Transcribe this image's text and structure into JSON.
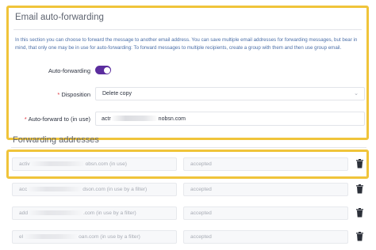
{
  "email_forwarding": {
    "title": "Email auto-forwarding",
    "description": "In this section you can choose to forward the message to another email address. You can save multiple email addresses for forwarding messages, but bear in mind, that only one may be in use for auto-forwarding: To forward messages to multiple recipients, create a group with them and then use group email.",
    "auto_forwarding_label": "Auto-forwarding",
    "auto_forwarding_enabled": true,
    "disposition_label": "Disposition",
    "disposition_value": "Delete copy",
    "forward_to_label": "Auto-forward to (in use)",
    "forward_to_prefix": "actr",
    "forward_to_suffix": "nobsn.com",
    "required_marker": "*"
  },
  "forwarding_addresses": {
    "title": "Forwarding addresses",
    "rows": [
      {
        "prefix": "activ",
        "suffix": "obsn.com (in use)",
        "status": "accepted"
      },
      {
        "prefix": "acc",
        "suffix": "dson.com (in use by a filter)",
        "status": "accepted"
      },
      {
        "prefix": "add",
        "suffix": ".com (in use by a filter)",
        "status": "accepted"
      },
      {
        "prefix": "el",
        "suffix": "oan.com (in use by a filter)",
        "status": "accepted"
      }
    ]
  },
  "colors": {
    "highlight": "#f0c43a",
    "toggle_on": "#5b2d9e",
    "required": "#e0323c",
    "description_text": "#4b6fa8"
  },
  "icons": {
    "delete": "trash-icon",
    "dropdown": "chevron-down-icon"
  }
}
